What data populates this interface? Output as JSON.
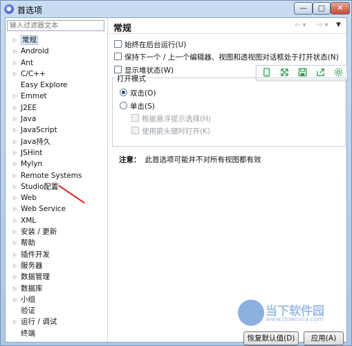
{
  "window": {
    "title": "首选项",
    "controls": {
      "minimize": "—",
      "maximize": "□",
      "close": "✕"
    }
  },
  "filter": {
    "placeholder": "输入过滤器文本"
  },
  "tree": {
    "items": [
      {
        "label": "常规",
        "expandable": true,
        "selected": true
      },
      {
        "label": "Android",
        "expandable": true
      },
      {
        "label": "Ant",
        "expandable": true
      },
      {
        "label": "C/C++",
        "expandable": true
      },
      {
        "label": "Easy Explore",
        "expandable": false
      },
      {
        "label": "Emmet",
        "expandable": true
      },
      {
        "label": "J2EE",
        "expandable": true
      },
      {
        "label": "Java",
        "expandable": true
      },
      {
        "label": "JavaScript",
        "expandable": true
      },
      {
        "label": "Java持久",
        "expandable": true
      },
      {
        "label": "JSHint",
        "expandable": true
      },
      {
        "label": "Mylyn",
        "expandable": true
      },
      {
        "label": "Remote Systems",
        "expandable": true
      },
      {
        "label": "Studio配置",
        "expandable": true
      },
      {
        "label": "Web",
        "expandable": true
      },
      {
        "label": "Web Service",
        "expandable": true
      },
      {
        "label": "XML",
        "expandable": true
      },
      {
        "label": "安装 / 更新",
        "expandable": true
      },
      {
        "label": "帮助",
        "expandable": true
      },
      {
        "label": "插件开发",
        "expandable": true
      },
      {
        "label": "服务器",
        "expandable": true
      },
      {
        "label": "数据管理",
        "expandable": true
      },
      {
        "label": "数据库",
        "expandable": true
      },
      {
        "label": "小组",
        "expandable": true
      },
      {
        "label": "验证",
        "expandable": false
      },
      {
        "label": "运行 / 调试",
        "expandable": true
      },
      {
        "label": "终端",
        "expandable": false
      }
    ]
  },
  "page": {
    "title": "常规",
    "options": {
      "run_in_background": {
        "label": "始终在后台运行(U)",
        "checked": false
      },
      "keep_next_prev": {
        "label": "保持下一个 / 上一个编辑器、视图和透视图对话框处于打开状态(N)",
        "checked": false
      },
      "show_heap": {
        "label": "显示堆状态(W)",
        "checked": false
      }
    },
    "open_mode": {
      "label": "打开模式",
      "double_click": {
        "label": "双击(O)",
        "selected": true
      },
      "single_click": {
        "label": "单击(S)",
        "selected": false
      },
      "hover_select": {
        "label": "根据悬浮提示选择(H)",
        "checked": false
      },
      "arrow_open": {
        "label": "使用箭头键时打开(K)",
        "checked": false
      }
    },
    "note": {
      "prefix": "注意：",
      "text": "此首选项可能并不对所有视图都有效"
    },
    "buttons": {
      "restore_defaults": "恢复默认值(D)",
      "apply": "应用(A)"
    }
  },
  "watermark": {
    "text": "当下软件园",
    "url": "www.downxia.com"
  },
  "colors": {
    "accent": "#2b9a4e",
    "annotation": "#e0242a",
    "selection": "#d9e7f7"
  }
}
